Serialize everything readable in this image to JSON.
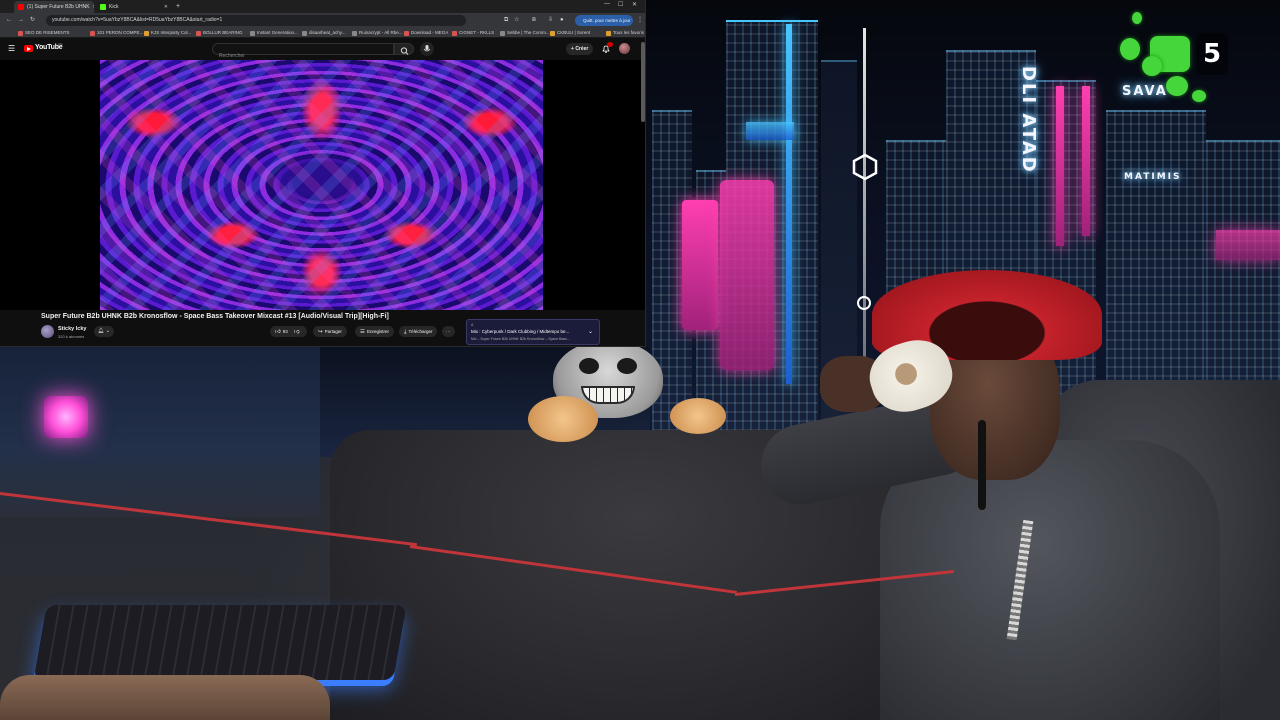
{
  "browser": {
    "tabs": [
      {
        "label": "(1) Super Future B2b UHNK",
        "favicon_color": "#ff0000",
        "active": true
      },
      {
        "label": "Kick",
        "favicon_color": "#53fc18",
        "active": false
      }
    ],
    "address": "youtube.com/watch?v=5uaYbzY8BCA&list=RD5uaYbzY8BCA&start_radio=1",
    "update_button": "Quitt. pour mettre à jour",
    "bookmarks": [
      "SEO DE RISEMENTS",
      "101 PERON COMPE...",
      "KJS Interparty Col...",
      "BOLLUR BEARING",
      "Instant Generation...",
      "disaarbeat_achy...",
      "Ruinacrypt - All Rbe...",
      "Download - MEGA",
      "CIGNET - RKLLS",
      "Sebbe | The Comm...",
      "CKBULI | Sorent"
    ],
    "bookmarks_all": "Tous les favoris"
  },
  "youtube": {
    "logo_text": "YouTube",
    "region": "FR",
    "search_placeholder": "Rechercher",
    "create_label": "Créer",
    "notif_badge": "9+",
    "video_title": "Super Future B2b UHNK B2b Kronosflow - Space Bass Takeover Mixcast #13 [Audio/Visual Trip][High-Fi]",
    "channel_name": "Sticky Icky",
    "subscribers": "320 k abonnés",
    "likes": "93",
    "share_label": "Partager",
    "save_label": "Enregistrer",
    "download_label": "Télécharger",
    "more_label": "···",
    "mix": {
      "line1": "A",
      "title": "Mix : Cyberpunk / Dark Clubbing / Midtempo be...",
      "subtitle": "Mix – Super Future B2b UHNK B2b Kronosflow – Space Bass..."
    }
  },
  "overlay": {
    "score": "5",
    "sign_left": "DLI ATAD",
    "sign_top": "SAVA",
    "sign_small": "MATIMIS"
  },
  "colors": {
    "accent_green": "#44d63a",
    "yt_red": "#ff0000",
    "cap_red": "#c4222a"
  }
}
